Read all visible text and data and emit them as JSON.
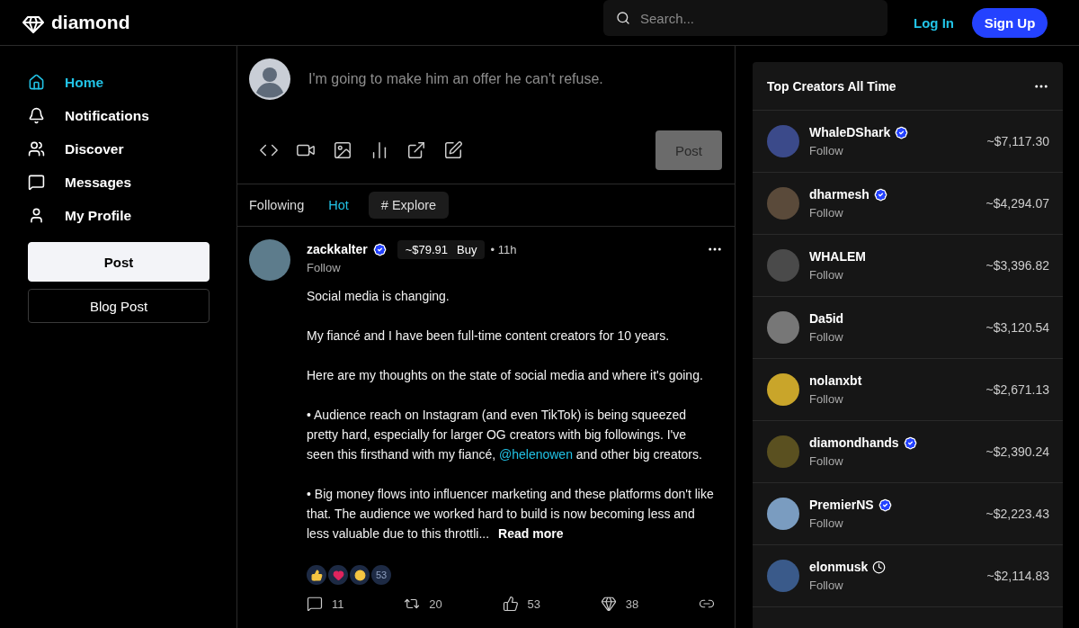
{
  "header": {
    "logo": "diamond",
    "search": {
      "placeholder": "Search..."
    },
    "login": "Log In",
    "signup": "Sign Up"
  },
  "sidebar": {
    "items": [
      {
        "label": "Home",
        "selected": true
      },
      {
        "label": "Notifications",
        "selected": false
      },
      {
        "label": "Discover",
        "selected": false
      },
      {
        "label": "Messages",
        "selected": false
      },
      {
        "label": "My Profile",
        "selected": false
      }
    ],
    "buttons": [
      {
        "label": "Post",
        "kind": "primary"
      },
      {
        "label": "Blog Post",
        "kind": "outline"
      }
    ]
  },
  "compose": {
    "placeholder": "I'm going to make him an offer he can't refuse.",
    "post_button": {
      "label": "Post",
      "disabled": true
    }
  },
  "feed_tabs": [
    {
      "label": "Following",
      "kind": "tab",
      "selected": false
    },
    {
      "label": "Hot",
      "kind": "tab",
      "selected": true
    },
    {
      "label": "# Explore",
      "kind": "pill",
      "selected": false
    }
  ],
  "post": {
    "author": "zackkalter",
    "verified": true,
    "price": "~$79.91",
    "buy": "Buy",
    "time": "• 11h",
    "follow": "Follow",
    "paragraphs": [
      [
        {
          "kind": "text",
          "text": "Social media is changing."
        }
      ],
      [
        {
          "kind": "text",
          "text": "My fiancé and I have been full-time content creators for 10 years."
        }
      ],
      [
        {
          "kind": "text",
          "text": "Here are my thoughts on the state of social media and where it's going."
        }
      ],
      [
        {
          "kind": "text",
          "text": "• Audience reach on Instagram (and even TikTok) is being squeezed pretty hard, especially for larger OG creators with big followings. I've seen this firsthand with my fiancé, "
        },
        {
          "kind": "mention",
          "text": "@helenowen"
        },
        {
          "kind": "text",
          "text": " and other big creators."
        }
      ],
      [
        {
          "kind": "text",
          "text": "• Big money flows into influencer marketing and these platforms don't like that. The audience we worked hard to build is now becoming less and less valuable due to this throttli..."
        }
      ]
    ],
    "read_more": "Read more",
    "reaction_count": "53",
    "action_counts": [
      "11",
      "20",
      "53",
      "38"
    ]
  },
  "top_creators": {
    "title": "Top Creators All Time",
    "rows": [
      {
        "name": "WhaleDShark",
        "verified": true,
        "pending": false,
        "follow": "Follow",
        "amount": "~$7,117.30"
      },
      {
        "name": "dharmesh",
        "verified": true,
        "pending": false,
        "follow": "Follow",
        "amount": "~$4,294.07"
      },
      {
        "name": "WHALEM",
        "verified": false,
        "pending": false,
        "follow": "Follow",
        "amount": "~$3,396.82"
      },
      {
        "name": "Da5id",
        "verified": false,
        "pending": false,
        "follow": "Follow",
        "amount": "~$3,120.54"
      },
      {
        "name": "nolanxbt",
        "verified": false,
        "pending": false,
        "follow": "Follow",
        "amount": "~$2,671.13"
      },
      {
        "name": "diamondhands",
        "verified": true,
        "pending": false,
        "follow": "Follow",
        "amount": "~$2,390.24"
      },
      {
        "name": "PremierNS",
        "verified": true,
        "pending": false,
        "follow": "Follow",
        "amount": "~$2,223.43"
      },
      {
        "name": "elonmusk",
        "verified": false,
        "pending": true,
        "follow": "Follow",
        "amount": "~$2,114.83"
      }
    ]
  }
}
